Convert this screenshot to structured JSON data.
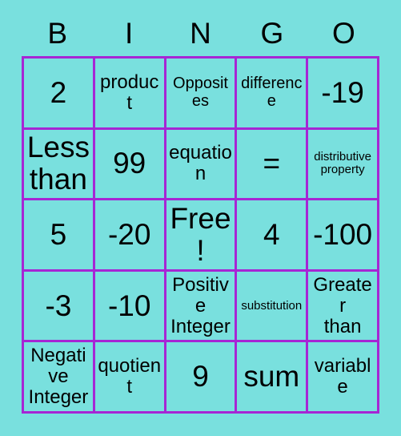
{
  "card": {
    "title": "Bingo Card",
    "background_color": "#79e0de",
    "border_color": "#a626d4",
    "text_color": "#000000"
  },
  "header": {
    "letters": [
      {
        "label": "B"
      },
      {
        "label": "I"
      },
      {
        "label": "N"
      },
      {
        "label": "G"
      },
      {
        "label": "O"
      }
    ]
  },
  "grid": {
    "columns": 5,
    "rows": 5,
    "free_space": "Free!",
    "cells": [
      {
        "text": "2",
        "size": "sz-xl",
        "column": "B",
        "row": 1
      },
      {
        "text": "product",
        "size": "sz-md",
        "column": "I",
        "row": 1
      },
      {
        "text": "Opposites",
        "size": "sz-sm",
        "column": "N",
        "row": 1
      },
      {
        "text": "difference",
        "size": "sz-sm",
        "column": "G",
        "row": 1
      },
      {
        "text": "-19",
        "size": "sz-xl",
        "column": "O",
        "row": 1
      },
      {
        "text": "Less\nthan",
        "size": "sz-xl",
        "column": "B",
        "row": 2
      },
      {
        "text": "99",
        "size": "sz-xl",
        "column": "I",
        "row": 2
      },
      {
        "text": "equation",
        "size": "sz-md",
        "column": "N",
        "row": 2
      },
      {
        "text": "=",
        "size": "sz-xl",
        "column": "G",
        "row": 2
      },
      {
        "text": "distributive\nproperty",
        "size": "sz-xs",
        "column": "O",
        "row": 2
      },
      {
        "text": "5",
        "size": "sz-xl",
        "column": "B",
        "row": 3
      },
      {
        "text": "-20",
        "size": "sz-xl",
        "column": "I",
        "row": 3
      },
      {
        "text": "Free!",
        "size": "sz-xl",
        "column": "N",
        "row": 3
      },
      {
        "text": "4",
        "size": "sz-xl",
        "column": "G",
        "row": 3
      },
      {
        "text": "-100",
        "size": "sz-xl",
        "column": "O",
        "row": 3
      },
      {
        "text": "-3",
        "size": "sz-xl",
        "column": "B",
        "row": 4
      },
      {
        "text": "-10",
        "size": "sz-xl",
        "column": "I",
        "row": 4
      },
      {
        "text": "Positive\nInteger",
        "size": "sz-md",
        "column": "N",
        "row": 4
      },
      {
        "text": "substitution",
        "size": "sz-xs",
        "column": "G",
        "row": 4
      },
      {
        "text": "Greater\nthan",
        "size": "sz-md",
        "column": "O",
        "row": 4
      },
      {
        "text": "Negative\nInteger",
        "size": "sz-md",
        "column": "B",
        "row": 5
      },
      {
        "text": "quotient",
        "size": "sz-md",
        "column": "I",
        "row": 5
      },
      {
        "text": "9",
        "size": "sz-xl",
        "column": "N",
        "row": 5
      },
      {
        "text": "sum",
        "size": "sz-xl",
        "column": "G",
        "row": 5
      },
      {
        "text": "variable",
        "size": "sz-md",
        "column": "O",
        "row": 5
      }
    ]
  }
}
